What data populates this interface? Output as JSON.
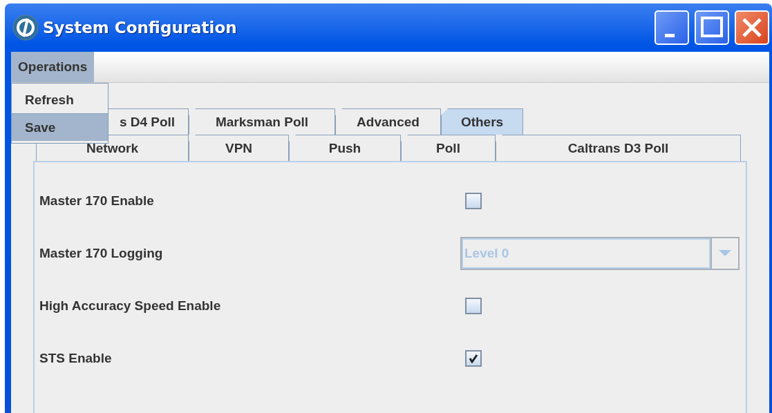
{
  "window": {
    "title": "System Configuration"
  },
  "menu_bar": [
    {
      "label": "Operations",
      "selected": true
    }
  ],
  "menu": {
    "items": [
      {
        "label": "Refresh",
        "selected": false
      },
      {
        "label": "Save",
        "selected": true
      }
    ]
  },
  "tab_rows": [
    [
      {
        "label": "s D4 Poll",
        "selected": false
      },
      {
        "label": "Marksman Poll",
        "selected": false
      },
      {
        "label": "Advanced",
        "selected": false
      },
      {
        "label": "Others",
        "selected": true
      }
    ],
    [
      {
        "label": "Network",
        "selected": false
      },
      {
        "label": "VPN",
        "selected": false
      },
      {
        "label": "Push",
        "selected": false
      },
      {
        "label": "Poll",
        "selected": false
      },
      {
        "label": "Caltrans D3 Poll",
        "selected": false
      }
    ]
  ],
  "settings": [
    {
      "kind": "checkbox",
      "label": "Master 170 Enable",
      "checked": false
    },
    {
      "kind": "dropdown",
      "label": "Master 170 Logging",
      "value": "Level 0",
      "disabled": true
    },
    {
      "kind": "checkbox",
      "label": "High Accuracy Speed Enable",
      "checked": false
    },
    {
      "kind": "checkbox",
      "label": "STS Enable",
      "checked": true
    }
  ]
}
